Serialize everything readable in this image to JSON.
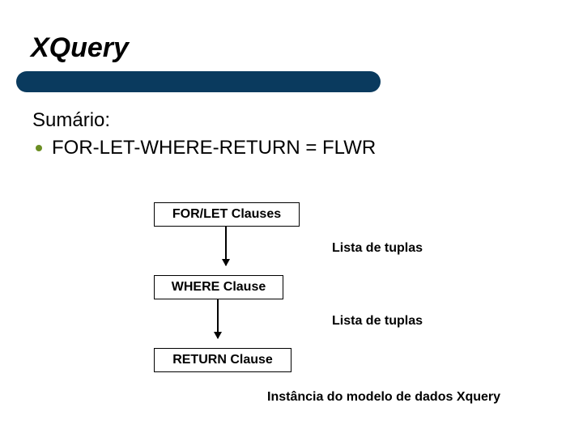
{
  "title": "XQuery",
  "summary_label": "Sumário:",
  "bullet": "FOR-LET-WHERE-RETURN  = FLWR",
  "diagram": {
    "box1": "FOR/LET Clauses",
    "box2": "WHERE Clause",
    "box3": "RETURN Clause",
    "annot1": "Lista de tuplas",
    "annot2": "Lista de tuplas",
    "annot3": "Instância do modelo de dados Xquery"
  }
}
